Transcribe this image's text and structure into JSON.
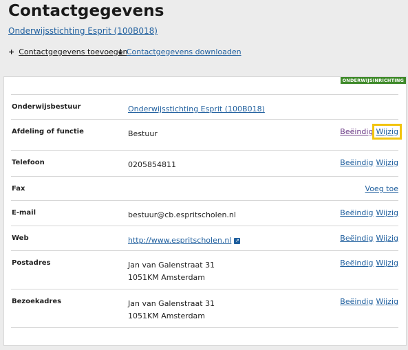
{
  "page": {
    "title": "Contactgegevens",
    "org_link": "Onderwijsstichting Esprit (100B018)"
  },
  "actions": [
    {
      "icon": "plus-icon",
      "label": "Contactgegevens toevoegen"
    },
    {
      "icon": "download-icon",
      "label": "Contactgegevens downloaden"
    }
  ],
  "badge": "ONDERWIJSINRICHTING",
  "rows": [
    {
      "label": "Onderwijsbestuur",
      "value": [
        "Onderwijsstichting Esprit (100B018)"
      ]
    },
    {
      "label": "Afdeling of functie",
      "value": [
        "Bestuur"
      ],
      "end": "Beëindig",
      "edit": "Wijzig"
    },
    {
      "label": "Telefoon",
      "value": [
        "0205854811"
      ],
      "end": "Beëindig",
      "edit": "Wijzig"
    },
    {
      "label": "Fax",
      "value": [],
      "add": "Voeg toe"
    },
    {
      "label": "E-mail",
      "value": [
        "bestuur@cb.espritscholen.nl"
      ],
      "end": "Beëindig",
      "edit": "Wijzig"
    },
    {
      "label": "Web",
      "value": [
        "http://www.espritscholen.nl"
      ],
      "end": "Beëindig",
      "edit": "Wijzig"
    },
    {
      "label": "Postadres",
      "value": [
        "Jan van Galenstraat 31",
        "1051KM Amsterdam"
      ],
      "end": "Beëindig",
      "edit": "Wijzig"
    },
    {
      "label": "Bezoekadres",
      "value": [
        "Jan van Galenstraat 31",
        "1051KM Amsterdam"
      ],
      "end": "Beëindig",
      "edit": "Wijzig"
    }
  ],
  "colors": {
    "link": "#1f5f9e",
    "badge": "#3f8a2a",
    "highlight": "#f2c40f"
  }
}
